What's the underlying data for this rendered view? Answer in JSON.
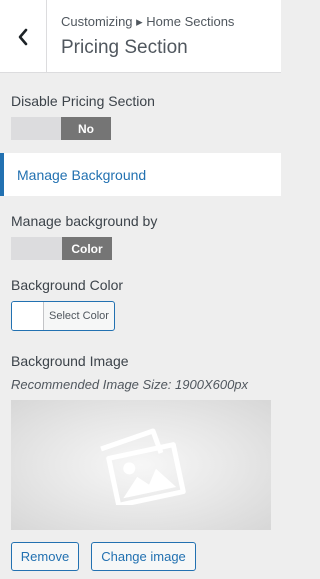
{
  "header": {
    "breadcrumb": "Customizing ▸ Home Sections",
    "title": "Pricing Section",
    "back_icon": "chevron-left-icon"
  },
  "disable_section": {
    "label": "Disable Pricing Section",
    "toggle_value": "No"
  },
  "manage_background_link": "Manage Background",
  "manage_by": {
    "label": "Manage background by",
    "toggle_value": "Color"
  },
  "background_color": {
    "label": "Background Color",
    "button_label": "Select Color",
    "swatch_color": "#ffffff"
  },
  "background_image": {
    "label": "Background Image",
    "hint": "Recommended Image Size: 1900X600px",
    "placeholder_icon": "image-placeholder-icon",
    "remove_label": "Remove",
    "change_label": "Change image"
  },
  "colors": {
    "accent": "#2271b1",
    "toggle_on": "#757575",
    "toggle_off": "#dcdcde",
    "panel_bg": "#eeeeee"
  }
}
